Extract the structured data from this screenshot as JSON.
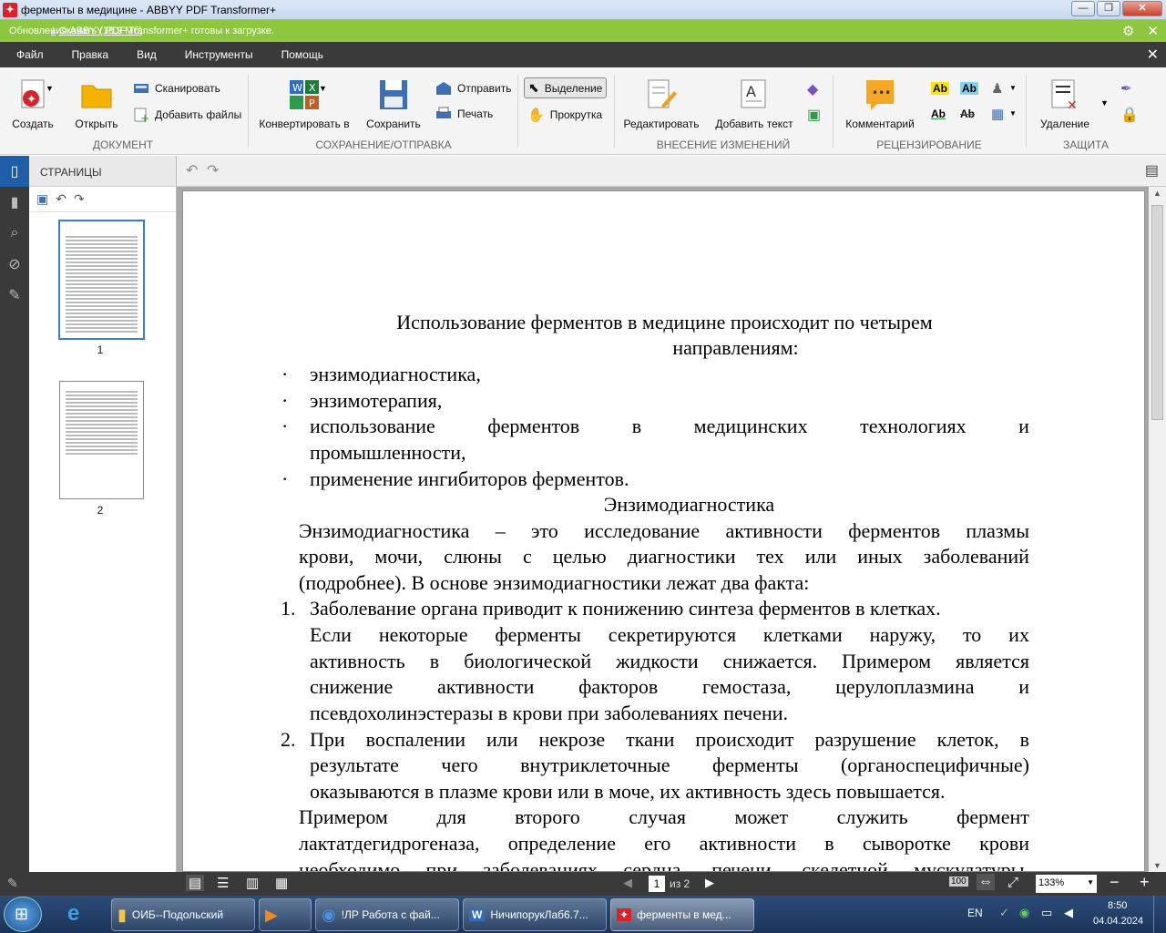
{
  "window": {
    "title": "ферменты в медицине - ABBYY PDF Transformer+"
  },
  "notification": {
    "message": "Обновления ABBYY PDF Transformer+ готовы к загрузке.",
    "download_link": "Скачать (18,9 Мб)"
  },
  "menu": [
    "Файл",
    "Правка",
    "Вид",
    "Инструменты",
    "Помощь"
  ],
  "ribbon": {
    "create": "Создать",
    "open": "Открыть",
    "scan": "Сканировать",
    "add_files": "Добавить файлы",
    "group_document": "ДОКУМЕНТ",
    "convert": "Конвертировать в",
    "save": "Сохранить",
    "send": "Отправить",
    "print": "Печать",
    "group_save": "СОХРАНЕНИЕ/ОТПРАВКА",
    "select": "Выделение",
    "scroll": "Прокрутка",
    "edit": "Редактировать",
    "add_text": "Добавить текст",
    "group_changes": "ВНЕСЕНИЕ ИЗМЕНЕНИЙ",
    "comment": "Комментарий",
    "group_review": "РЕЦЕНЗИРОВАНИЕ",
    "delete": "Удаление",
    "group_protect": "ЗАЩИТА"
  },
  "pages_panel": {
    "header": "СТРАНИЦЫ",
    "thumbs": [
      "1",
      "2"
    ]
  },
  "document": {
    "title_l1": "Использование ферментов в медицине происходит по четырем",
    "title_l2": "направлениям:",
    "bullet": "·",
    "b1": "энзимодиагностика,",
    "b2": "энзимотерапия,",
    "b3_words": [
      "использование",
      "ферментов",
      "в",
      "медицинских",
      "технологиях",
      "и"
    ],
    "b3_l2": "промышленности,",
    "b4": "применение ингибиторов ферментов.",
    "heading": "Энзимодиагностика",
    "p1_l1": [
      "Энзимодиагностика",
      "–",
      "это",
      "исследование",
      "активности",
      "ферментов",
      "плазмы"
    ],
    "p1_l2": [
      "крови,",
      "мочи,",
      "слюны",
      "с",
      "целью",
      "диагностики",
      "тех",
      "или",
      "иных",
      "заболеваний"
    ],
    "p1_l3": "(подробнее). В основе энзимодиагностики лежат два факта:",
    "n1": "1.",
    "i1_l1": "Заболевание органа приводит к понижению синтеза ферментов в клетках.",
    "i1_l2": [
      "Если",
      "некоторые",
      "ферменты",
      "секретируются",
      "клетками",
      "наружу,",
      "то",
      "их"
    ],
    "i1_l3": [
      "активность",
      "в",
      "биологической",
      "жидкости",
      "снижается.",
      "Примером",
      "является"
    ],
    "i1_l4": [
      "снижение",
      "активности",
      "факторов",
      "гемостаза,",
      "церулоплазмина",
      "и"
    ],
    "i1_l5": "псевдохолинэстеразы в крови при заболеваниях печени.",
    "n2": "2.",
    "i2_l1": [
      "При",
      "воспалении",
      "или",
      "некрозе",
      "ткани",
      "происходит",
      "разрушение",
      "клеток,",
      "в"
    ],
    "i2_l2": [
      "результате",
      "чего",
      "внутриклеточные",
      "ферменты",
      "(органоспецифичные)"
    ],
    "i2_l3": "оказываются в плазме крови или в моче, их активность здесь повышается.",
    "p2_l1": [
      "Примером",
      "для",
      "второго",
      "случая",
      "может",
      "служить",
      "фермент"
    ],
    "p2_l2": [
      "лактатдегидрогеназа,",
      "определение",
      "его",
      "активности",
      "в",
      "сыворотке",
      "крови"
    ],
    "p2_l3": [
      "необходимо",
      "при",
      "заболеваниях",
      "сердца,",
      "печени,",
      "скелетной",
      "мускулатуры,"
    ]
  },
  "status": {
    "page_input": "1",
    "page_of": "из 2",
    "zoom": "133%"
  },
  "taskbar": {
    "items": [
      "ОИБ--Подольский",
      "!ЛР Работа с фай...",
      "НичипорукЛаб6.7...",
      "ферменты в мед..."
    ],
    "lang": "EN",
    "time": "8:50",
    "date": "04.04.2024"
  }
}
